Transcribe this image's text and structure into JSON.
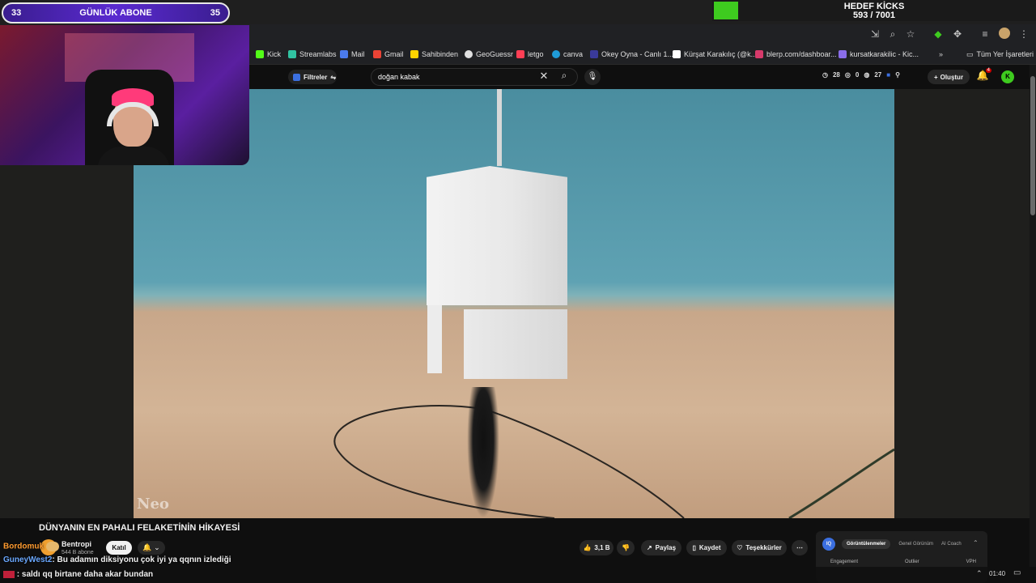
{
  "overlay": {
    "daily_sub_label": "GÜNLÜK ABONE",
    "daily_sub_current": "33",
    "daily_sub_goal": "35",
    "kicks_label": "HEDEF KİCKS",
    "kicks_progress": "593 / 7001"
  },
  "bookmarks": [
    {
      "label": "Kick",
      "color": "#53fc18"
    },
    {
      "label": "Streamlabs",
      "color": "#31c3a2"
    },
    {
      "label": "Mail",
      "color": "#4b7bec"
    },
    {
      "label": "Gmail",
      "color": "#ea4335"
    },
    {
      "label": "Sahibinden",
      "color": "#ffd400"
    },
    {
      "label": "GeoGuessr",
      "color": "#e0e0e0"
    },
    {
      "label": "letgo",
      "color": "#ff3f55"
    },
    {
      "label": "canva",
      "color": "#1f9bd7"
    },
    {
      "label": "Okey Oyna - Canlı 1...",
      "color": "#3a3a9a"
    },
    {
      "label": "Kürşat Karakılıç (@k...",
      "color": "#ffffff"
    },
    {
      "label": "blerp.com/dashboar...",
      "color": "#d63a6b"
    },
    {
      "label": "kursatkarakilic - Kic...",
      "color": "#8a6de9"
    }
  ],
  "bookmarks_all": "Tüm Yer İşaretleri",
  "yt_header": {
    "filters_label": "Filtreler",
    "search_value": "doğan kabak",
    "stat_1": "28",
    "stat_2": "0",
    "stat_3": "27",
    "create_label": "Oluştur",
    "notif_count": "4",
    "avatar_letter": "K"
  },
  "video": {
    "watermark": "Neo",
    "title": "DÜNYANIN EN PAHALI FELAKETİNİN HİKAYESİ"
  },
  "channel": {
    "name": "Bentropi",
    "subs": "544 B abone",
    "join_label": "Katıl",
    "bell_label": "🔔 ⌄"
  },
  "actions": {
    "like_label": "3,1 B",
    "share_label": "Paylaş",
    "save_label": "Kaydet",
    "thanks_label": "Teşekkürler"
  },
  "insights": {
    "logo": "IQ",
    "tab_1": "Görüntülenmeler",
    "tab_2": "Genel Görünüm",
    "tab_3": "AI Coach",
    "col_1": "Engagement",
    "col_2": "Outlier",
    "col_3": "VPH"
  },
  "chat": [
    {
      "user": "Bordomuk",
      "user_color": "#ff9b2f",
      "text": ""
    },
    {
      "user": "GuneyWest2",
      "user_color": "#6aa8ff",
      "text": ": Bu adamın diksiyonu çok iyi ya qqnın izlediği"
    },
    {
      "user": "",
      "user_color": "#ffffff",
      "text": ": saldı qq birtane daha akar bundan"
    }
  ],
  "clock": "01:40"
}
